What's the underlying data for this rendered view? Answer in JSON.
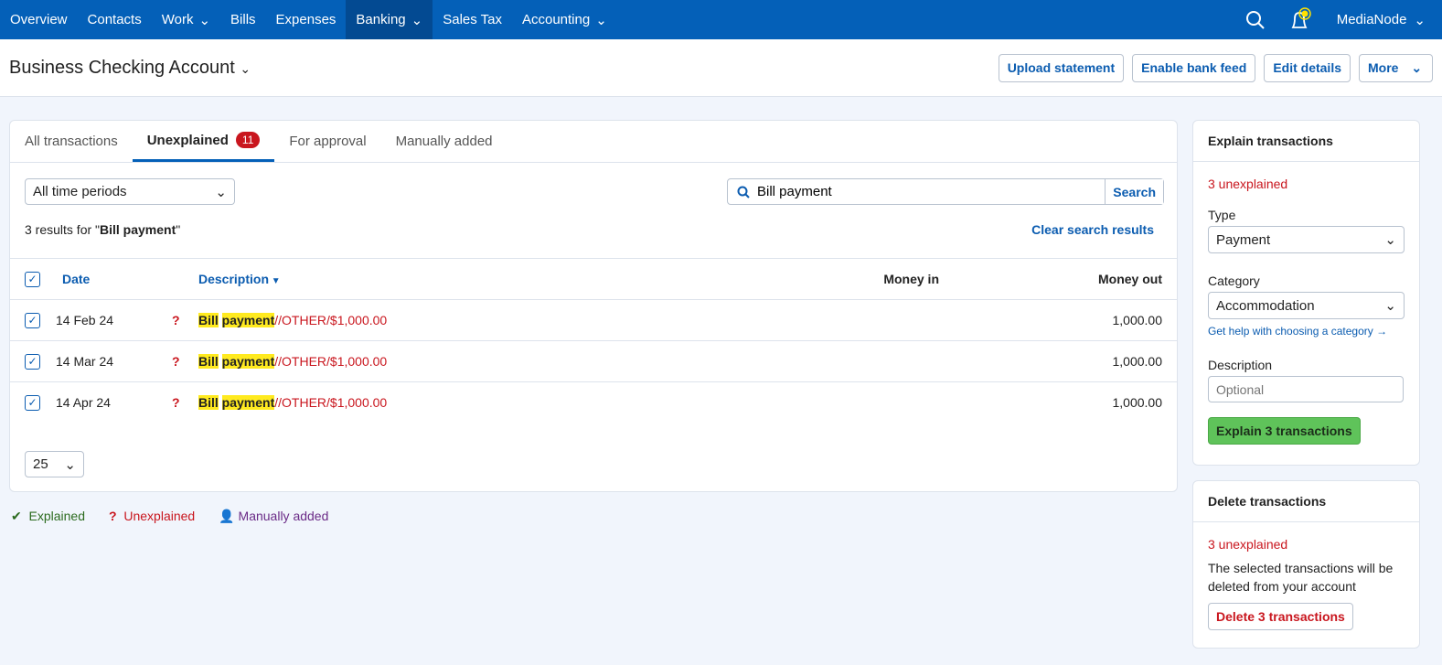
{
  "nav": {
    "items": [
      {
        "label": "Overview"
      },
      {
        "label": "Contacts"
      },
      {
        "label": "Work",
        "chevron": true
      },
      {
        "label": "Bills"
      },
      {
        "label": "Expenses"
      },
      {
        "label": "Banking",
        "chevron": true,
        "active": true
      },
      {
        "label": "Sales Tax"
      },
      {
        "label": "Accounting",
        "chevron": true
      }
    ],
    "user": "MediaNode"
  },
  "header": {
    "title": "Business Checking Account",
    "buttons": [
      "Upload statement",
      "Enable bank feed",
      "Edit details",
      "More"
    ]
  },
  "tabs": [
    {
      "label": "All transactions"
    },
    {
      "label": "Unexplained",
      "badge": "11"
    },
    {
      "label": "For approval"
    },
    {
      "label": "Manually added"
    }
  ],
  "filter": {
    "period": "All time periods",
    "search_value": "Bill payment",
    "search_button": "Search",
    "results_prefix": "3 results for \"",
    "results_term": "Bill payment",
    "results_suffix": "\"",
    "clear": "Clear search results"
  },
  "table": {
    "headers": {
      "date": "Date",
      "description": "Description",
      "money_in": "Money in",
      "money_out": "Money out"
    },
    "rows": [
      {
        "date": "14 Feb 24",
        "hl1": "Bill",
        "hl2": "payment",
        "rest": "//OTHER/$1,000.00",
        "money_out": "1,000.00"
      },
      {
        "date": "14 Mar 24",
        "hl1": "Bill",
        "hl2": "payment",
        "rest": "//OTHER/$1,000.00",
        "money_out": "1,000.00"
      },
      {
        "date": "14 Apr 24",
        "hl1": "Bill",
        "hl2": "payment",
        "rest": "//OTHER/$1,000.00",
        "money_out": "1,000.00"
      }
    ],
    "page_size": "25"
  },
  "legend": {
    "explained": "Explained",
    "unexplained": "Unexplained",
    "manual": "Manually added"
  },
  "explain": {
    "title": "Explain transactions",
    "count": "3 unexplained",
    "type_label": "Type",
    "type_value": "Payment",
    "category_label": "Category",
    "category_value": "Accommodation",
    "help": "Get help with choosing a category →",
    "desc_label": "Description",
    "desc_placeholder": "Optional",
    "button": "Explain 3 transactions"
  },
  "delete": {
    "title": "Delete transactions",
    "count": "3 unexplained",
    "text": "The selected transactions will be deleted from your account",
    "button": "Delete 3 transactions"
  }
}
